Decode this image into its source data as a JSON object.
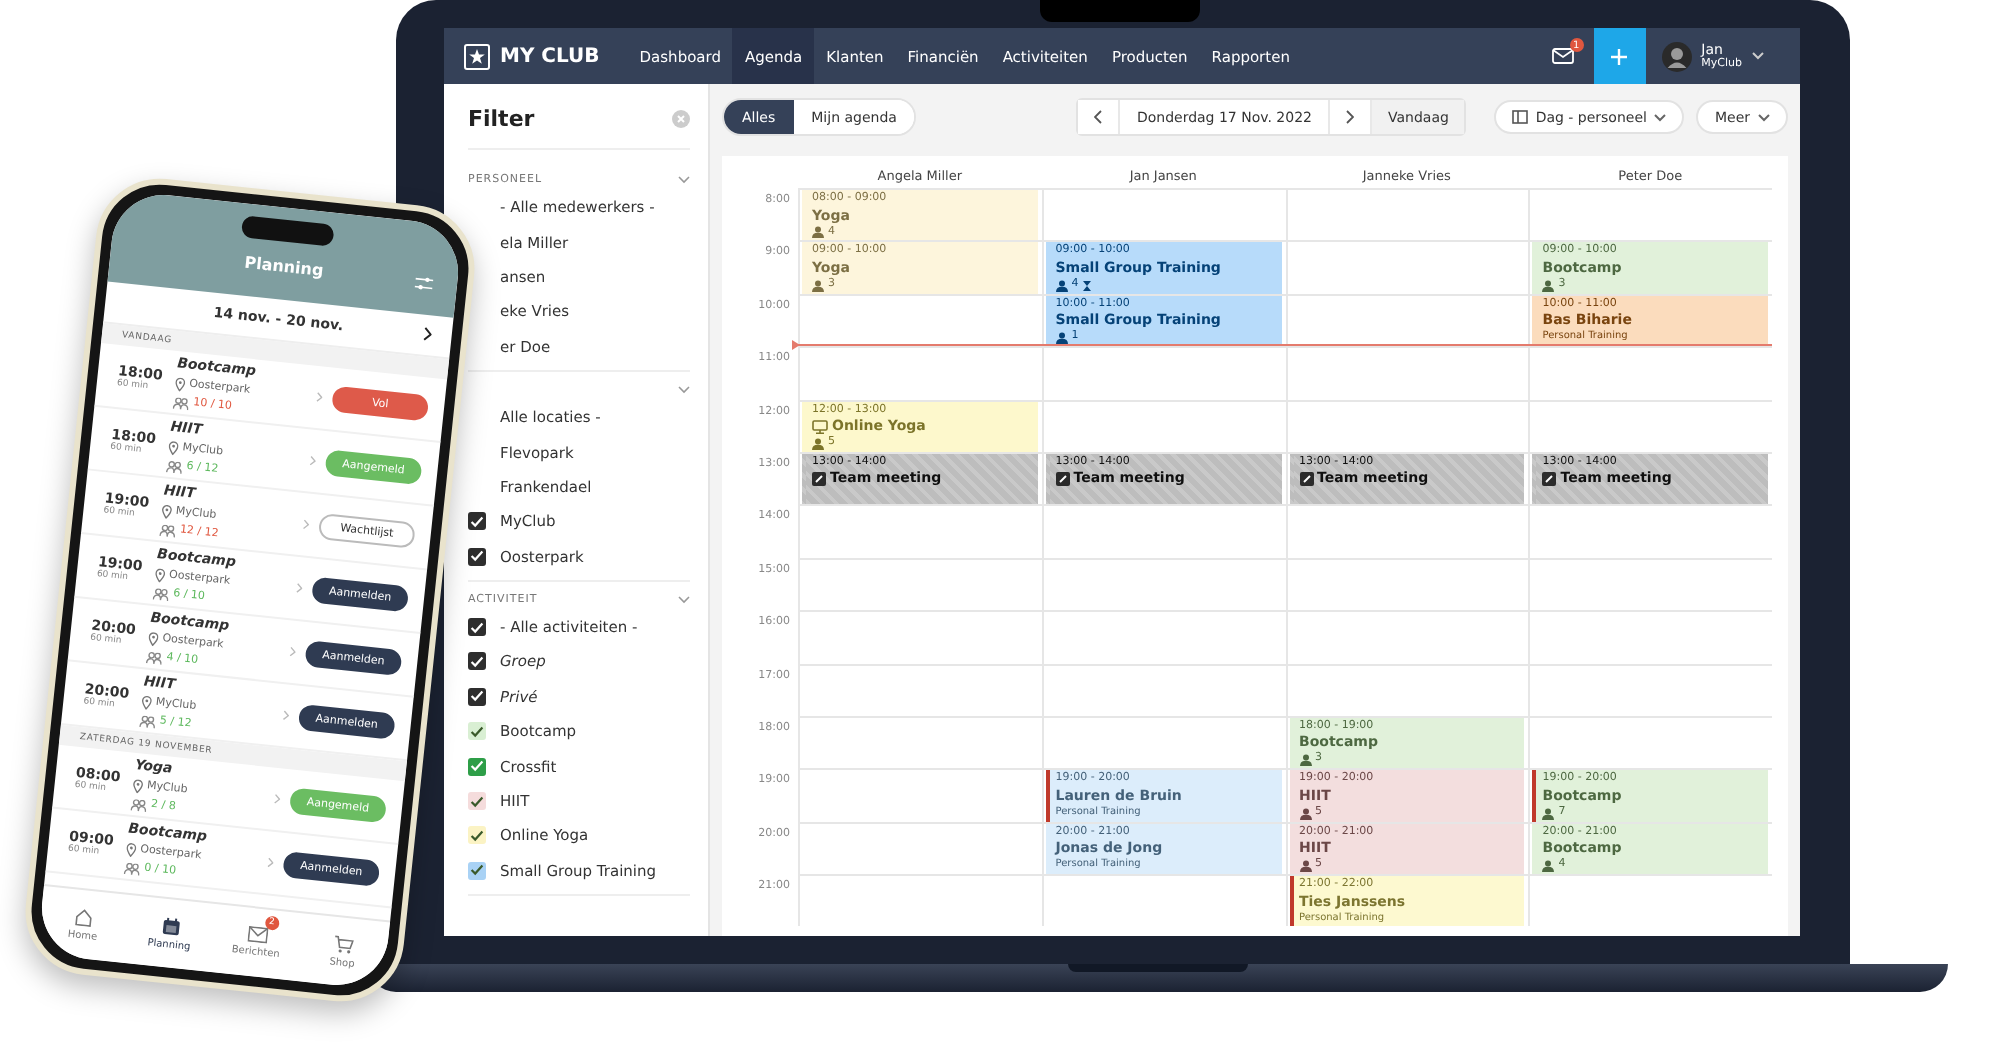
{
  "topbar": {
    "logo": "MY CLUB",
    "nav": [
      {
        "label": "Dashboard",
        "selected": false
      },
      {
        "label": "Agenda",
        "selected": true
      },
      {
        "label": "Klanten",
        "selected": false
      },
      {
        "label": "Financiën",
        "selected": false
      },
      {
        "label": "Activiteiten",
        "selected": false
      },
      {
        "label": "Producten",
        "selected": false
      },
      {
        "label": "Rapporten",
        "selected": false
      }
    ],
    "mail_badge": "1",
    "user": {
      "name": "Jan",
      "club": "MyClub"
    }
  },
  "sidebar": {
    "title": "Filter",
    "sections": [
      {
        "heading": "PERSONEEL",
        "items": [
          {
            "label": "- Alle medewerkers -",
            "kind": "option"
          },
          {
            "label": "ela Miller",
            "kind": "option"
          },
          {
            "label": "ansen",
            "kind": "option"
          },
          {
            "label": "eke Vries",
            "kind": "option"
          },
          {
            "label": "er Doe",
            "kind": "option"
          }
        ]
      },
      {
        "items": [
          {
            "label": "Alle locaties -",
            "kind": "option"
          },
          {
            "label": "Flevopark",
            "kind": "option"
          },
          {
            "label": "Frankendael",
            "kind": "option"
          },
          {
            "label": "MyClub",
            "kind": "option",
            "checked": true
          },
          {
            "label": "Oosterpark",
            "kind": "option",
            "checked": true
          }
        ]
      },
      {
        "heading": "ACTIVITEIT",
        "items": [
          {
            "label": "- Alle activiteiten -",
            "kind": "option",
            "checked": true
          },
          {
            "label": "Groep",
            "kind": "type",
            "checked": true
          },
          {
            "label": "Privé",
            "kind": "type",
            "checked": true
          },
          {
            "label": "Bootcamp",
            "kind": "option",
            "checked": true,
            "color": "#d9efd3"
          },
          {
            "label": "Crossfit",
            "kind": "option",
            "checked": true,
            "color": "#2e9e48"
          },
          {
            "label": "HIIT",
            "kind": "option",
            "checked": true,
            "color": "#f5dcdc"
          },
          {
            "label": "Online Yoga",
            "kind": "option",
            "checked": true,
            "color": "#fbf3c4"
          },
          {
            "label": "Small Group Training",
            "kind": "option",
            "checked": true,
            "color": "#a9d2f5"
          }
        ]
      }
    ]
  },
  "toolbar": {
    "scope": [
      {
        "label": "Alles",
        "selected": true
      },
      {
        "label": "Mijn agenda",
        "selected": false
      }
    ],
    "date": "Donderdag 17 Nov. 2022",
    "today": "Vandaag",
    "view": "Dag - personeel",
    "more": "Meer"
  },
  "calendar": {
    "hours": [
      {
        "label": "8:00",
        "now": false
      },
      {
        "label": "9:00",
        "now": false
      },
      {
        "label": "10:00",
        "now": false
      },
      {
        "label": "11:00",
        "now": true
      },
      {
        "label": "12:00",
        "now": false
      },
      {
        "label": "13:00",
        "now": false
      },
      {
        "label": "14:00",
        "now": false
      },
      {
        "label": "15:00",
        "now": false
      },
      {
        "label": "16:00",
        "now": false
      },
      {
        "label": "17:00",
        "now": false
      },
      {
        "label": "18:00",
        "now": false
      },
      {
        "label": "19:00",
        "now": false
      },
      {
        "label": "20:00",
        "now": false
      },
      {
        "label": "21:00",
        "now": false
      }
    ],
    "columns": [
      {
        "name": "Angela Miller",
        "cells": [
          {
            "kind": "class",
            "time": "08:00 - 09:00",
            "title": "Yoga",
            "count": "4",
            "color": "#fdf5dc",
            "marked": false,
            "waitlist": false,
            "online": false
          },
          {
            "kind": "class",
            "time": "09:00 - 10:00",
            "title": "Yoga",
            "count": "3",
            "color": "#fdf5dc",
            "marked": false,
            "waitlist": false,
            "online": false
          },
          null,
          null,
          {
            "kind": "class",
            "time": "12:00 - 13:00",
            "title": "Online Yoga",
            "count": "5",
            "color": "#fdf8cc",
            "marked": false,
            "waitlist": false,
            "online": true
          },
          {
            "kind": "meeting",
            "time": "13:00 - 14:00",
            "title": "Team meeting",
            "color": "#bdbdbd",
            "marked": false
          },
          null,
          null,
          null,
          null,
          null,
          null,
          null,
          null
        ]
      },
      {
        "name": "Jan Jansen",
        "cells": [
          null,
          {
            "kind": "class",
            "time": "09:00 - 10:00",
            "title": "Small Group Training",
            "count": "4",
            "color": "#b7dbfa",
            "marked": false,
            "waitlist": true,
            "online": false
          },
          {
            "kind": "class",
            "time": "10:00 - 11:00",
            "title": "Small Group Training",
            "count": "1",
            "color": "#b7dbfa",
            "marked": false,
            "waitlist": false,
            "online": false
          },
          null,
          null,
          {
            "kind": "meeting",
            "time": "13:00 - 14:00",
            "title": "Team meeting",
            "color": "#bdbdbd",
            "marked": false
          },
          null,
          null,
          null,
          null,
          null,
          {
            "kind": "personal",
            "time": "19:00 - 20:00",
            "title": "Lauren de Bruin",
            "subtitle": "Personal Training",
            "color": "#dcedfb",
            "marked": true
          },
          {
            "kind": "personal",
            "time": "20:00 - 21:00",
            "title": "Jonas de Jong",
            "subtitle": "Personal Training",
            "color": "#dcedfb",
            "marked": false
          },
          null
        ]
      },
      {
        "name": "Janneke Vries",
        "cells": [
          null,
          null,
          null,
          null,
          null,
          {
            "kind": "meeting",
            "time": "13:00 - 14:00",
            "title": "Team meeting",
            "color": "#bdbdbd",
            "marked": false
          },
          null,
          null,
          null,
          null,
          {
            "kind": "class",
            "time": "18:00 - 19:00",
            "title": "Bootcamp",
            "count": "3",
            "color": "#e1f1da",
            "marked": false,
            "waitlist": false,
            "online": false
          },
          {
            "kind": "class",
            "time": "19:00 - 20:00",
            "title": "HIIT",
            "count": "5",
            "color": "#f3dede",
            "marked": false,
            "waitlist": false,
            "online": false
          },
          {
            "kind": "class",
            "time": "20:00 - 21:00",
            "title": "HIIT",
            "count": "5",
            "color": "#f3dede",
            "marked": false,
            "waitlist": false,
            "online": false
          },
          {
            "kind": "personal",
            "time": "21:00 - 22:00",
            "title": "Ties Janssens",
            "subtitle": "Personal Training",
            "color": "#fdf9d0",
            "marked": true
          }
        ]
      },
      {
        "name": "Peter Doe",
        "cells": [
          null,
          {
            "kind": "class",
            "time": "09:00 - 10:00",
            "title": "Bootcamp",
            "count": "3",
            "color": "#e1f1da",
            "marked": false,
            "waitlist": false,
            "online": false
          },
          {
            "kind": "personal",
            "time": "10:00 - 11:00",
            "title": "Bas Biharie",
            "subtitle": "Personal Training",
            "color": "#fbdcbd",
            "marked": false
          },
          null,
          null,
          {
            "kind": "meeting",
            "time": "13:00 - 14:00",
            "title": "Team meeting",
            "color": "#bdbdbd",
            "marked": false
          },
          null,
          null,
          null,
          null,
          null,
          {
            "kind": "class",
            "time": "19:00 - 20:00",
            "title": "Bootcamp",
            "count": "7",
            "color": "#e1f1da",
            "marked": true,
            "waitlist": false,
            "online": false
          },
          {
            "kind": "class",
            "time": "20:00 - 21:00",
            "title": "Bootcamp",
            "count": "4",
            "color": "#e1f1da",
            "marked": false,
            "waitlist": false,
            "online": false
          },
          null
        ]
      }
    ]
  },
  "phone": {
    "title": "Planning",
    "range": "14 nov. - 20 nov.",
    "sections": [
      {
        "heading": "VANDAAG",
        "rows": [
          {
            "time": "18:00",
            "duration": "60 min",
            "title": "Bootcamp",
            "location": "Oosterpark",
            "count": "10 / 10",
            "color": "#e0573f",
            "button": {
              "label": "Vol",
              "kind": "full"
            }
          },
          {
            "time": "18:00",
            "duration": "60 min",
            "title": "HIIT",
            "location": "MyClub",
            "count": "6 / 12",
            "color": "#5cb85c",
            "button": {
              "label": "Aangemeld",
              "kind": "joined"
            }
          },
          {
            "time": "19:00",
            "duration": "60 min",
            "title": "HIIT",
            "location": "MyClub",
            "count": "12 / 12",
            "color": "#e0573f",
            "button": {
              "label": "Wachtlijst",
              "kind": "waitlist"
            }
          },
          {
            "time": "19:00",
            "duration": "60 min",
            "title": "Bootcamp",
            "location": "Oosterpark",
            "count": "6 / 10",
            "color": "#5cb85c",
            "button": {
              "label": "Aanmelden",
              "kind": "join"
            }
          },
          {
            "time": "20:00",
            "duration": "60 min",
            "title": "Bootcamp",
            "location": "Oosterpark",
            "count": "4 / 10",
            "color": "#5cb85c",
            "button": {
              "label": "Aanmelden",
              "kind": "join"
            }
          },
          {
            "time": "20:00",
            "duration": "60 min",
            "title": "HIIT",
            "location": "MyClub",
            "count": "5 / 12",
            "color": "#5cb85c",
            "button": {
              "label": "Aanmelden",
              "kind": "join"
            }
          }
        ]
      },
      {
        "heading": "ZATERDAG 19 NOVEMBER",
        "rows": [
          {
            "time": "08:00",
            "duration": "60 min",
            "title": "Yoga",
            "location": "MyClub",
            "count": "2 / 8",
            "color": "#5cb85c",
            "button": {
              "label": "Aangemeld",
              "kind": "joined"
            }
          },
          {
            "time": "09:00",
            "duration": "60 min",
            "title": "Bootcamp",
            "location": "Oosterpark",
            "count": "0 / 10",
            "color": "#5cb85c",
            "button": {
              "label": "Aanmelden",
              "kind": "join"
            }
          }
        ]
      }
    ],
    "nav": [
      {
        "label": "Home",
        "kind": "home",
        "selected": false
      },
      {
        "label": "Planning",
        "kind": "calendar",
        "selected": true
      },
      {
        "label": "Berichten",
        "kind": "mail",
        "selected": false,
        "badge": "2"
      },
      {
        "label": "Shop",
        "kind": "cart",
        "selected": false
      }
    ]
  }
}
